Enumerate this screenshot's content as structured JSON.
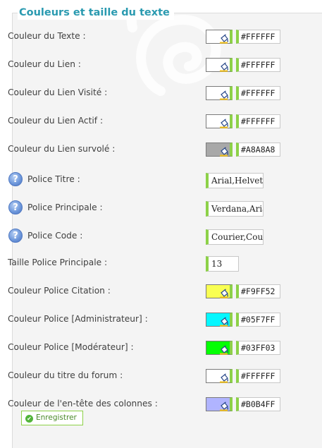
{
  "section": {
    "title": "Couleurs et taille du texte"
  },
  "rows": [
    {
      "label": "Couleur du Texte  :",
      "type": "color",
      "value": "#FFFFFF",
      "swatch": "#FFFFFF"
    },
    {
      "label": "Couleur du Lien  :",
      "type": "color",
      "value": "#FFFFFF",
      "swatch": "#FFFFFF"
    },
    {
      "label": "Couleur du Lien Visité  :",
      "type": "color",
      "value": "#FFFFFF",
      "swatch": "#FFFFFF"
    },
    {
      "label": "Couleur du Lien Actif  :",
      "type": "color",
      "value": "#FFFFFF",
      "swatch": "#FFFFFF"
    },
    {
      "label": "Couleur du Lien survolé  :",
      "type": "color",
      "value": "#A8A8A8",
      "swatch": "#A8A8A8"
    },
    {
      "label": "Police Titre  :",
      "type": "text",
      "help": true,
      "value": "Arial,Helvetica"
    },
    {
      "label": "Police Principale  :",
      "type": "text",
      "help": true,
      "value": "Verdana,Arial"
    },
    {
      "label": "Police Code  :",
      "type": "text",
      "help": true,
      "value": "Courier,Courier New"
    },
    {
      "label": "Taille Police Principale  :",
      "type": "small",
      "value": "13"
    },
    {
      "label": "Couleur Police Citation  :",
      "type": "color",
      "value": "#F9FF52",
      "swatch": "#F9FF52"
    },
    {
      "label": "Couleur Police [Administrateur]  :",
      "type": "color",
      "value": "#05F7FF",
      "swatch": "#05F7FF"
    },
    {
      "label": "Couleur Police [Modérateur]  :",
      "type": "color",
      "value": "#03FF03",
      "swatch": "#03FF03"
    },
    {
      "label": "Couleur du titre du forum  :",
      "type": "color",
      "value": "#FFFFFF",
      "swatch": "#FFFFFF"
    },
    {
      "label": "Couleur de l'en-tête des colonnes  :",
      "type": "color",
      "value": "#B0B4FF",
      "swatch": "#B0B4FF"
    }
  ],
  "help_icon_glyph": "?",
  "save_button": {
    "label": "Enregistrer",
    "icon": "check-circle-icon"
  },
  "colors": {
    "accent_green": "#8DD148",
    "title_blue": "#2A9AB0",
    "panel_bg": "#F4F4F4"
  }
}
